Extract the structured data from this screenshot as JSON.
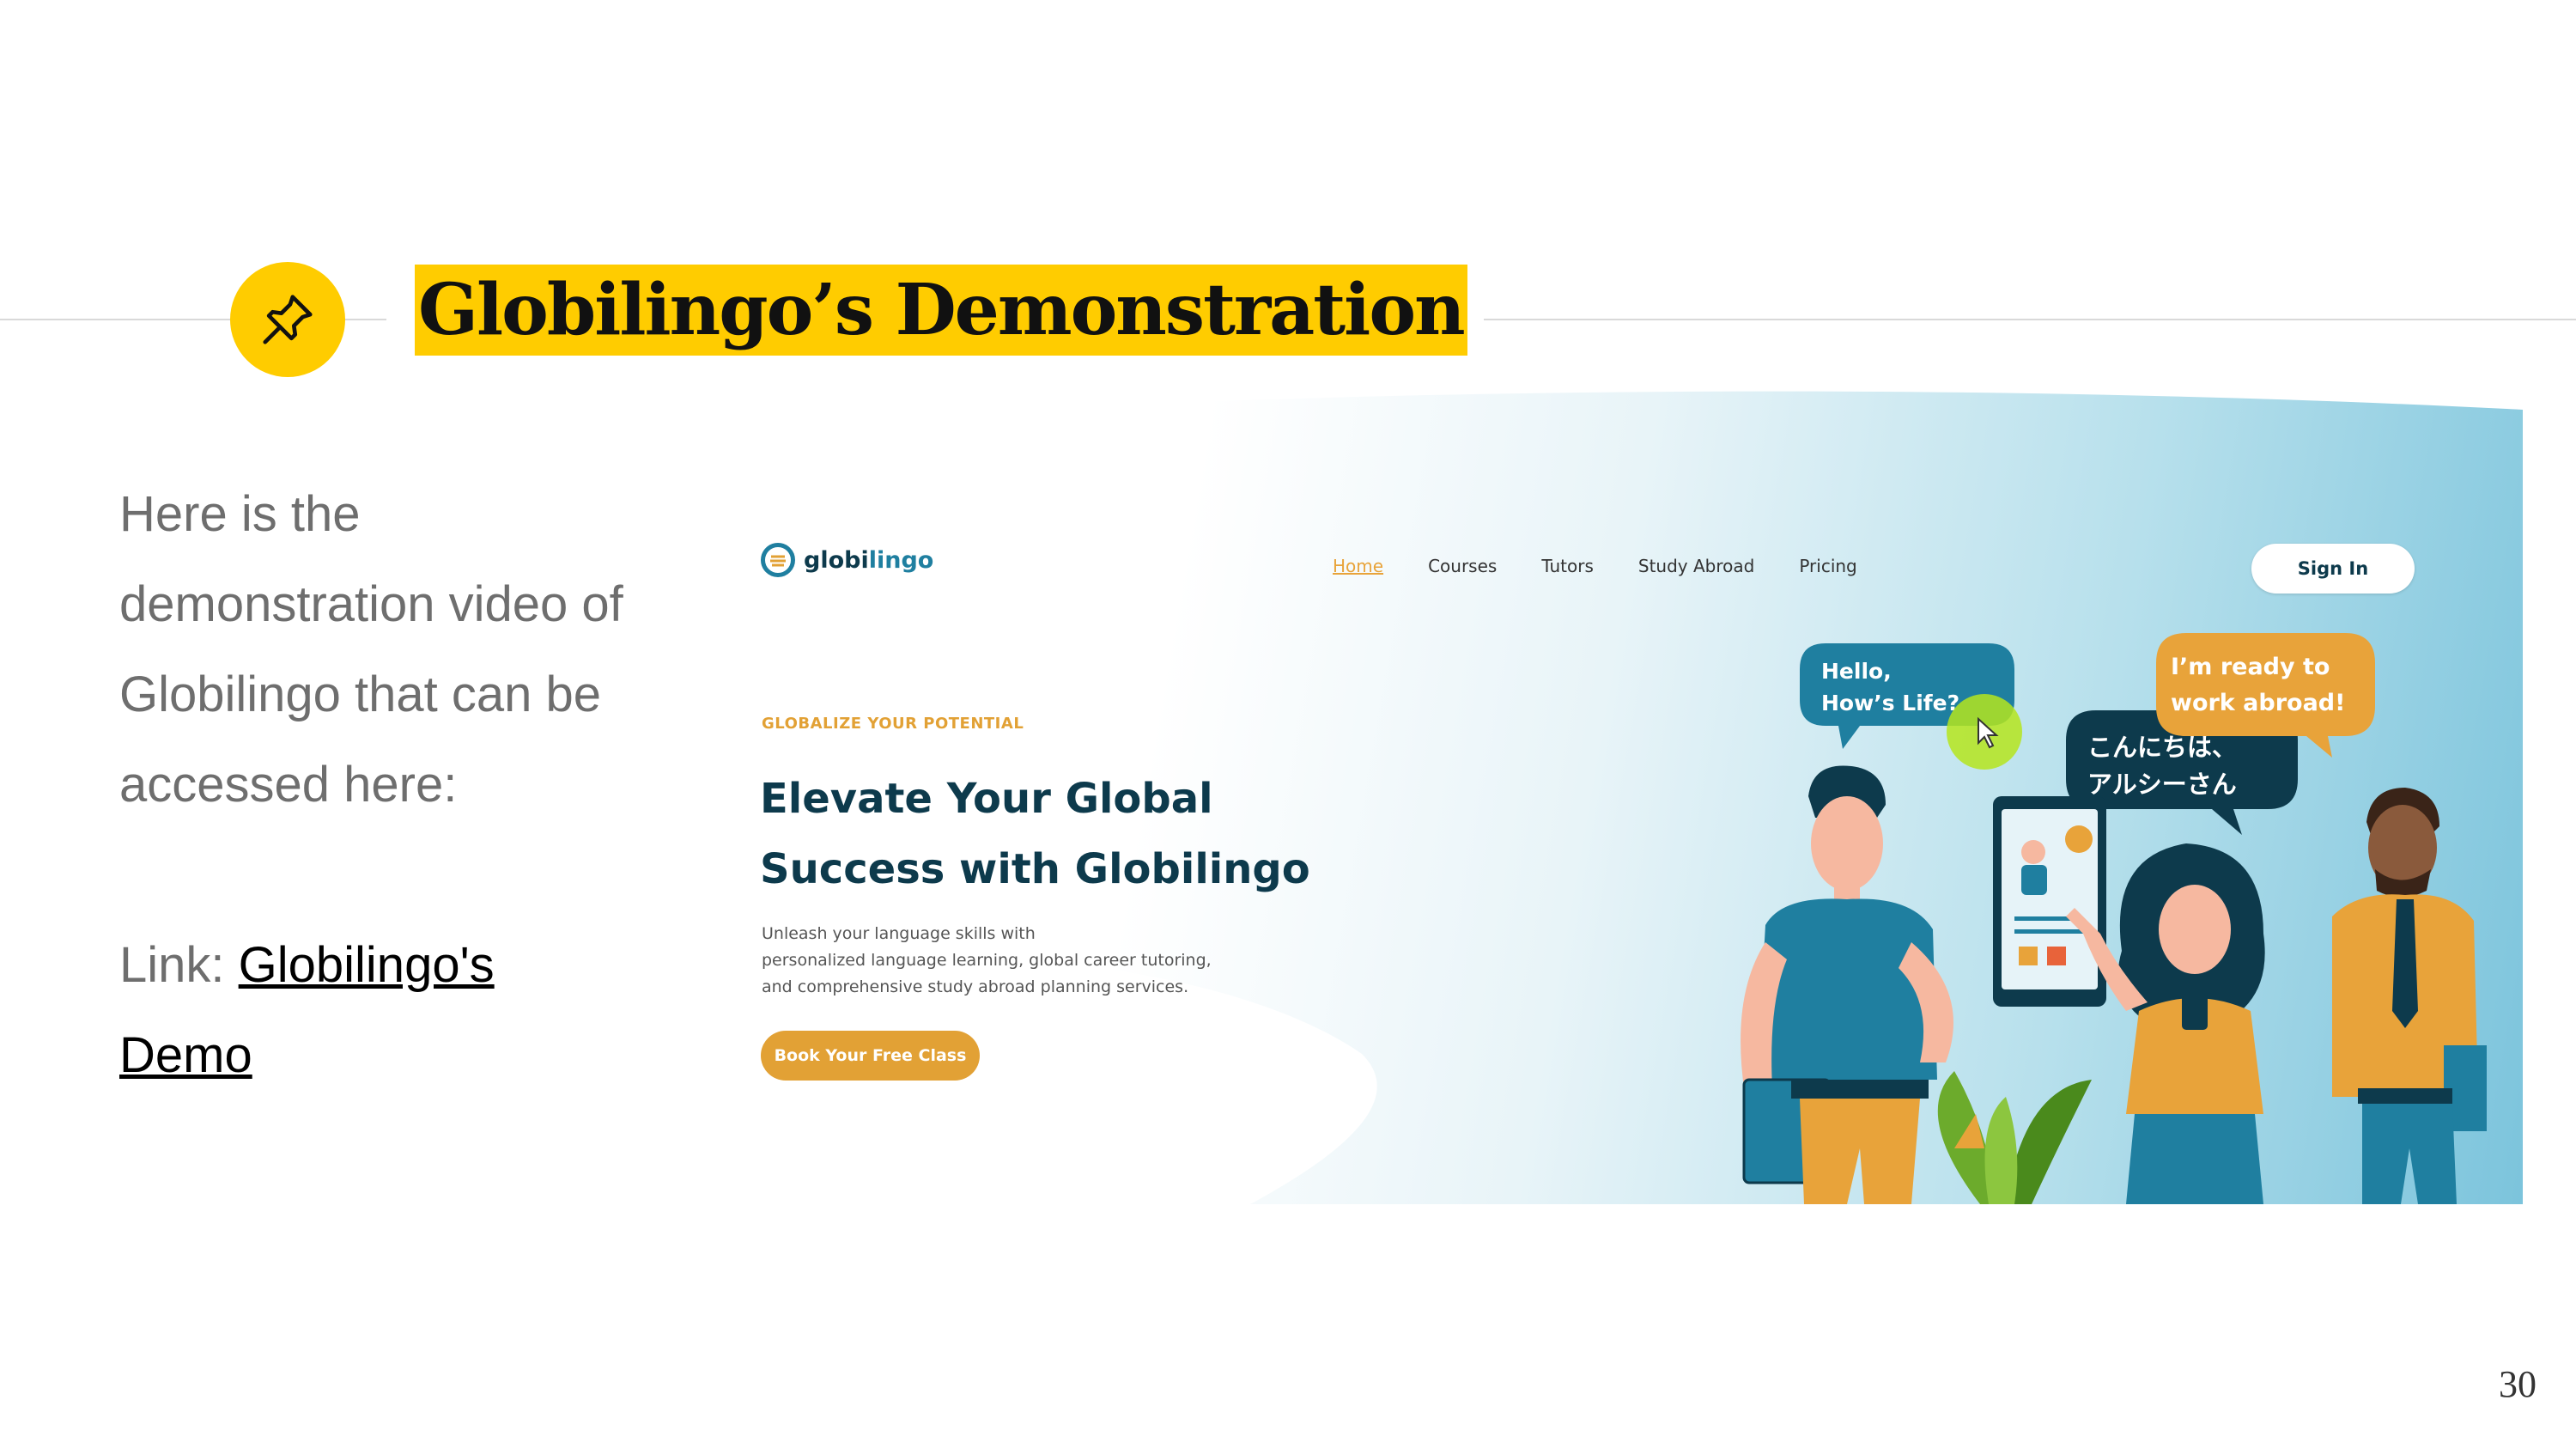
{
  "slide": {
    "title": "Globilingo’s Demonstration",
    "body_lines": [
      "Here is the",
      "demonstration video of",
      "Globilingo that can be",
      "accessed here:"
    ],
    "link_prefix": "Link: ",
    "link_text_1": "Globilingo's",
    "link_text_2": "Demo",
    "page_number": "30",
    "accent_color": "#ffcc00",
    "pin_icon": "pushpin-icon"
  },
  "screenshot": {
    "brand_prefix": "globi",
    "brand_accent": "lingo",
    "nav": [
      "Home",
      "Courses",
      "Tutors",
      "Study Abroad",
      "Pricing"
    ],
    "active_nav": "Home",
    "sign_in_label": "Sign In",
    "eyebrow": "GLOBALIZE YOUR POTENTIAL",
    "headline_line1": "Elevate Your Global",
    "headline_line2": "Success with Globilingo",
    "description_line1": "Unleash your language skills with",
    "description_line2": "personalized language learning, global career tutoring,",
    "description_line3": "and comprehensive study abroad planning services.",
    "cta_label": "Book Your Free Class",
    "bubble_hello_1": "Hello,",
    "bubble_hello_2": "How’s Life?",
    "bubble_jp_1": "こんにちは、",
    "bubble_jp_2": "アルシーさん",
    "bubble_ready_1": "I’m ready to",
    "bubble_ready_2": "work abroad!",
    "colors": {
      "navy": "#0d3a4c",
      "orange": "#e2a135",
      "teal": "#1f7fa0"
    }
  }
}
